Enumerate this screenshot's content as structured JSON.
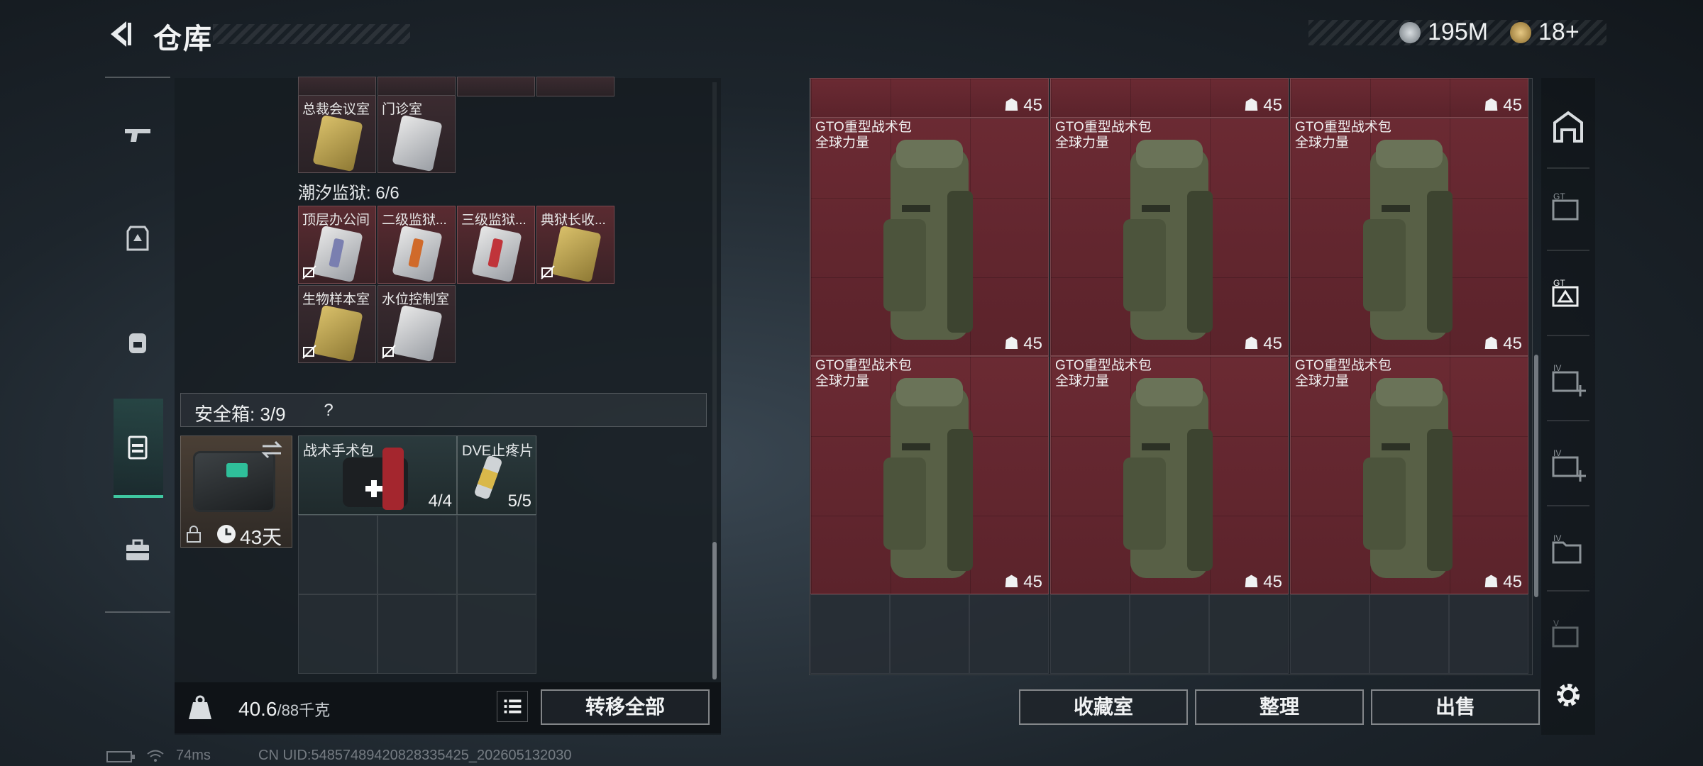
{
  "header": {
    "title": "仓库"
  },
  "currency": {
    "coins": "195M",
    "tokens": "18+"
  },
  "keycards": {
    "top_row": [
      {
        "label": "总裁会议室",
        "color": "gold"
      },
      {
        "label": "门诊室",
        "color": "silver"
      }
    ],
    "section_title": "潮汐监狱: 6/6",
    "prison_row1": [
      {
        "label": "顶层办公间",
        "color": "silver",
        "stripe": "#7a7fb0"
      },
      {
        "label": "二级监狱...",
        "color": "silver",
        "stripe": "#d06a2a"
      },
      {
        "label": "三级监狱...",
        "color": "silver",
        "stripe": "#c0343a"
      },
      {
        "label": "典狱长收...",
        "color": "gold",
        "stripe": "#d9c06a"
      }
    ],
    "prison_row2": [
      {
        "label": "生物样本室",
        "color": "gold",
        "stripe": "#d9c06a"
      },
      {
        "label": "水位控制室",
        "color": "silver",
        "stripe": "#8a8fa8"
      }
    ]
  },
  "safebox": {
    "label": "安全箱: 3/9",
    "help": "?",
    "duration": "43天",
    "items": [
      {
        "label": "战术手术包",
        "count": "4/4"
      },
      {
        "label": "DVE止疼片",
        "count": "5/5"
      }
    ]
  },
  "bottom": {
    "weight": "40.6",
    "weight_max": "/88千克",
    "transfer_all": "转移全部",
    "collection": "收藏室",
    "sort": "整理",
    "sell": "出售"
  },
  "backpacks": {
    "top_counts": [
      "45",
      "45",
      "45"
    ],
    "items": [
      {
        "name": "GTO重型战术包",
        "sub": "全球力量",
        "count": "45"
      },
      {
        "name": "GTO重型战术包",
        "sub": "全球力量",
        "count": "45"
      },
      {
        "name": "GTO重型战术包",
        "sub": "全球力量",
        "count": "45"
      },
      {
        "name": "GTO重型战术包",
        "sub": "全球力量",
        "count": "45"
      },
      {
        "name": "GTO重型战术包",
        "sub": "全球力量",
        "count": "45"
      },
      {
        "name": "GTO重型战术包",
        "sub": "全球力量",
        "count": "45"
      }
    ]
  },
  "footer": {
    "ping": "74ms",
    "uid": "CN UID:548574894208283354​25_202605132030"
  },
  "colors": {
    "accent": "#3fc7a0",
    "item_red": "#6b2a33"
  }
}
